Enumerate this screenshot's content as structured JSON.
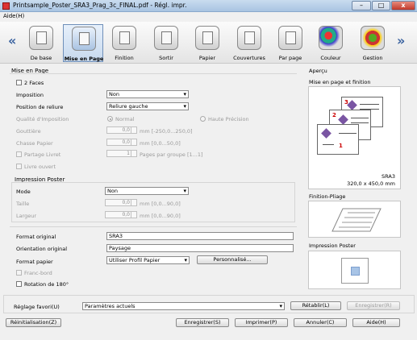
{
  "window": {
    "title": "Printsample_Poster_SRA3_Prag_3c_FINAL.pdf - Régl. impr.",
    "min": "–",
    "max": "□",
    "close": "x"
  },
  "menu": {
    "aide": "Aide(H)"
  },
  "tabs": [
    {
      "label": "De base",
      "icon": "basic-icon"
    },
    {
      "label": "Mise en Page",
      "icon": "layout-icon"
    },
    {
      "label": "Finition",
      "icon": "finishing-icon"
    },
    {
      "label": "Sortir",
      "icon": "output-tray-icon"
    },
    {
      "label": "Papier",
      "icon": "paper-icon"
    },
    {
      "label": "Couvertures",
      "icon": "cover-icon"
    },
    {
      "label": "Par page",
      "icon": "per-page-icon"
    },
    {
      "label": "Couleur",
      "icon": "color-icon"
    },
    {
      "label": "Gestion",
      "icon": "management-icon"
    }
  ],
  "nav": {
    "left": "«",
    "right": "»"
  },
  "layout": {
    "group_title": "Mise en Page",
    "two_sides": "2 Faces",
    "imposition_label": "Imposition",
    "imposition_value": "Non",
    "binding_label": "Position de reliure",
    "binding_value": "Reliure gauche",
    "quality_label": "Qualité d'Imposition",
    "quality_normal": "Normal",
    "quality_high": "Haute Précision",
    "gutter_label": "Gouttière",
    "gutter_value": "0,0",
    "gutter_unit": "mm [-250,0...250,0]",
    "creep_label": "Chasse Papier",
    "creep_value": "0,0",
    "creep_unit": "mm [0,0...50,0]",
    "split_booklet": "Partage Livret",
    "split_value": "1",
    "split_unit": "Pages par groupe [1...1]",
    "open_book": "Livre ouvert"
  },
  "poster": {
    "group_title": "Impression Poster",
    "mode_label": "Mode",
    "mode_value": "Non",
    "size_label": "Taille",
    "size_value": "0,0",
    "size_unit": "mm [0,0...90,0]",
    "width_label": "Largeur",
    "width_value": "0,0",
    "width_unit": "mm [0,0...90,0]"
  },
  "format": {
    "original_label": "Format original",
    "original_value": "SRA3",
    "orientation_label": "Orientation original",
    "orientation_value": "Paysage",
    "paper_label": "Format papier",
    "paper_value": "Utiliser Profil Papier",
    "customize": "Personnalisé...",
    "bleed": "Franc-bord",
    "rotate": "Rotation de 180°"
  },
  "preview": {
    "title": "Aperçu",
    "subtitle": "Mise en page et finition",
    "pages": [
      "3",
      "2",
      "1"
    ],
    "size_name": "SRA3",
    "size_dims": "320,0 x 450,0 mm",
    "finishing_label": "Finition-Pliage",
    "poster_label": "Impression Poster"
  },
  "favorites": {
    "label": "Réglage favori(U)",
    "value": "Paramètres actuels",
    "restore": "Rétablir(L)",
    "save": "Enregistrer(R)"
  },
  "footer": {
    "reset": "Réinitialisation(Z)",
    "register": "Enregistrer(S)",
    "print": "Imprimer(P)",
    "cancel": "Annuler(C)",
    "help": "Aide(H)"
  },
  "colors": {
    "accent": "#3b63a0",
    "page_number": "#cc0000"
  }
}
